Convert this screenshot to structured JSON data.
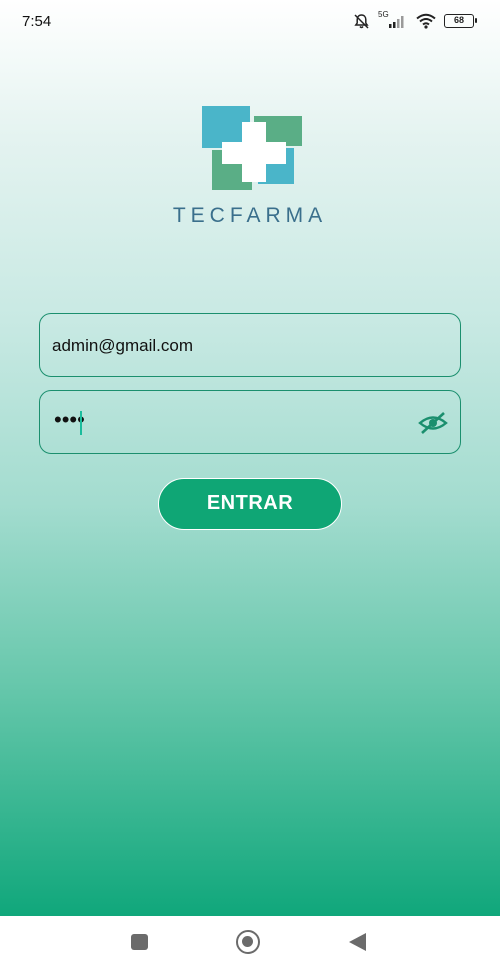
{
  "status_bar": {
    "time": "7:54",
    "network_label": "5G",
    "battery": "68",
    "icons": [
      "bell-off-icon",
      "signal-icon",
      "wifi-icon",
      "battery-icon"
    ]
  },
  "app": {
    "brand": "TECFARMA",
    "colors": {
      "accent": "#0fa675",
      "brand_text": "#3a6f8c",
      "logo_blue": "#4ab5c9",
      "logo_green": "#5aae86"
    }
  },
  "login": {
    "email_value": "admin@gmail.com",
    "password_value": "••••",
    "toggle_icon": "eye-off-icon",
    "submit_label": "ENTRAR"
  },
  "nav_bar": {
    "icons": [
      "recent-apps-icon",
      "home-icon",
      "back-icon"
    ]
  }
}
